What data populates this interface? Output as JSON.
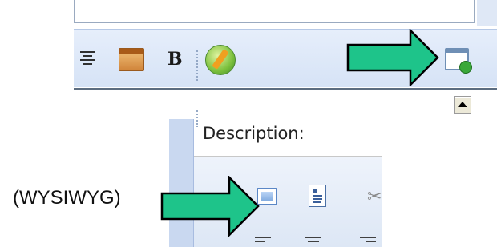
{
  "bottom_editor": {
    "field_label": "Description:"
  },
  "callout": {
    "label": "(WYSIWYG)"
  },
  "icons": {
    "top_toolbar": [
      "align-center-icon",
      "html-source-icon",
      "bold-icon",
      "insert-image-icon",
      "popout-editor-icon",
      "scroll-up-icon"
    ],
    "bottom_toolbar": [
      "wysiwyg-mode-icon",
      "template-icon",
      "cut-icon",
      "align-left-icon",
      "align-center-icon",
      "align-right-icon"
    ]
  },
  "colors": {
    "arrow_fill": "#1ec48a",
    "arrow_stroke": "#000000",
    "toolbar_bg": "#dde7f5",
    "sidebar_bg": "#c9d8f0"
  }
}
